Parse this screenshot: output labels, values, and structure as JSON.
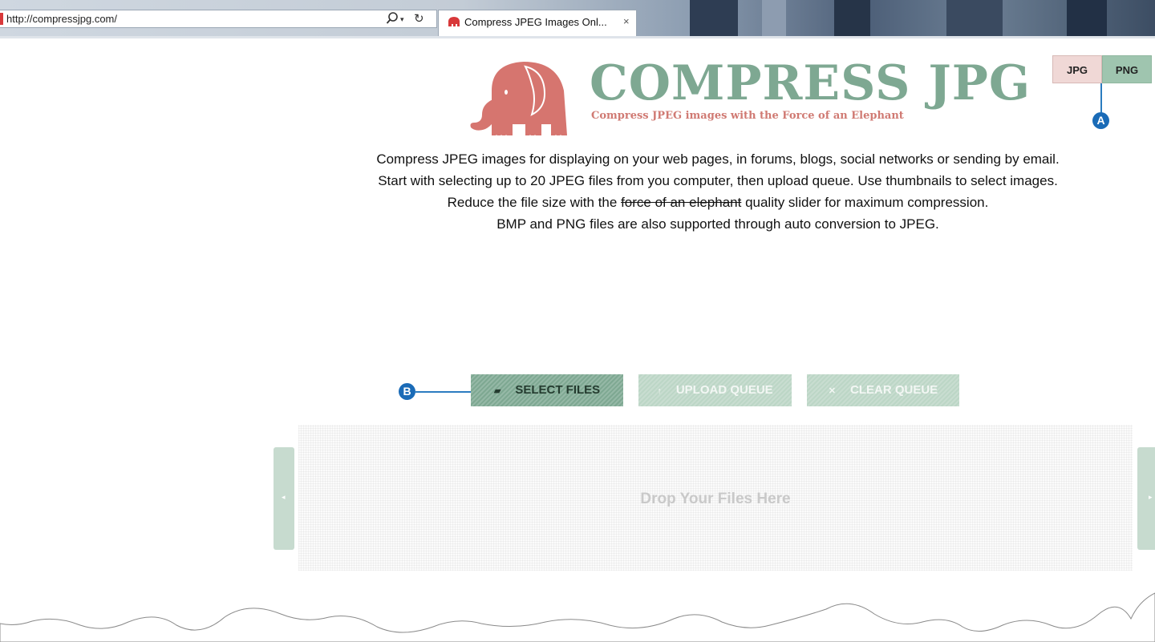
{
  "browser": {
    "address_url": "http://compressjpg.com/",
    "tab_title": "Compress JPEG Images Onl...",
    "tab_close": "×",
    "search_icon": "search-icon",
    "refresh_icon": "refresh-icon"
  },
  "logo": {
    "title": "COMPRESS JPG",
    "tagline": "Compress JPEG images with the Force of an Elephant",
    "icon": "elephant-icon",
    "elephant_color": "#d6756f"
  },
  "format_toggle": {
    "jpg_label": "JPG",
    "png_label": "PNG"
  },
  "callouts": {
    "a_label": "A",
    "b_label": "B",
    "color": "#1a6bb7"
  },
  "description": {
    "line1": "Compress JPEG images for displaying on your web pages, in forums, blogs, social networks or sending by email.",
    "line2": "Start with selecting up to 20 JPEG files from you computer, then upload queue. Use thumbnails to select images.",
    "line3_before": "Reduce the file size with the ",
    "line3_strike": "force of an elephant",
    "line3_after": " quality slider for maximum compression.",
    "line4": "BMP and PNG files are also supported through auto conversion to JPEG."
  },
  "actions": {
    "select_files": "SELECT FILES",
    "upload_queue": "UPLOAD QUEUE",
    "clear_queue": "CLEAR QUEUE",
    "select_icon": "folder-open-icon",
    "upload_icon": "arrow-up-icon",
    "clear_icon": "close-icon",
    "accent_color": "#7ea892"
  },
  "dropzone": {
    "text": "Drop Your Files Here",
    "left_arrow": "◂",
    "right_arrow": "▸"
  }
}
